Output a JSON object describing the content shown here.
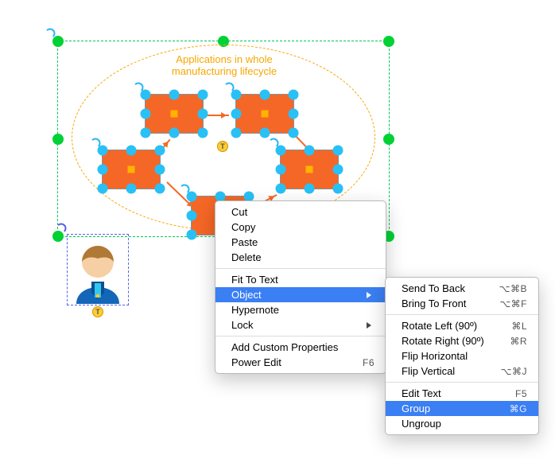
{
  "diagram": {
    "ellipse_label": "Applications in whole manufacturing lifecycle"
  },
  "menu": {
    "cut": "Cut",
    "copy": "Copy",
    "paste": "Paste",
    "delete": "Delete",
    "fit_to_text": "Fit To Text",
    "object": "Object",
    "hypernote": "Hypernote",
    "lock": "Lock",
    "add_custom_properties": "Add Custom Properties",
    "power_edit": "Power Edit",
    "power_edit_shortcut": "F6"
  },
  "submenu": {
    "send_to_back": "Send To Back",
    "send_to_back_shortcut": "⌥⌘B",
    "bring_to_front": "Bring To Front",
    "bring_to_front_shortcut": "⌥⌘F",
    "rotate_left": "Rotate Left (90º)",
    "rotate_left_shortcut": "⌘L",
    "rotate_right": "Rotate Right (90º)",
    "rotate_right_shortcut": "⌘R",
    "flip_horizontal": "Flip Horizontal",
    "flip_vertical": "Flip Vertical",
    "flip_vertical_shortcut": "⌥⌘J",
    "edit_text": "Edit Text",
    "edit_text_shortcut": "F5",
    "group": "Group",
    "group_shortcut": "⌘G",
    "ungroup": "Ungroup"
  }
}
